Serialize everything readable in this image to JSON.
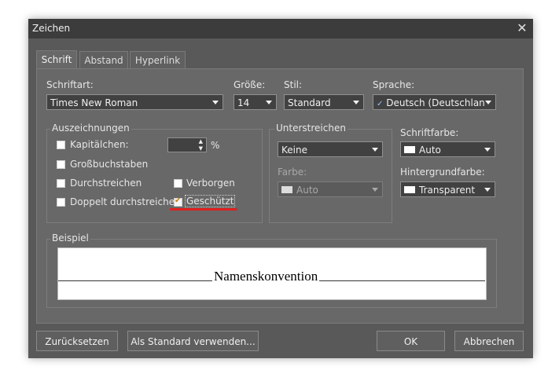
{
  "window": {
    "title": "Zeichen"
  },
  "tabs": [
    {
      "label": "Schrift"
    },
    {
      "label": "Abstand"
    },
    {
      "label": "Hyperlink"
    }
  ],
  "font_row": {
    "font_label": "Schriftart:",
    "font_value": "Times New Roman",
    "size_label": "Größe:",
    "size_value": "14",
    "style_label": "Stil:",
    "style_value": "Standard",
    "lang_label": "Sprache:",
    "lang_value": "Deutsch (Deutschlan"
  },
  "effects": {
    "group_label": "Auszeichnungen",
    "kapitaelchen": "Kapitälchen:",
    "percent": "%",
    "grossbuchstaben": "Großbuchstaben",
    "durchstreichen": "Durchstreichen",
    "verborgen": "Verborgen",
    "doppelt": "Doppelt durchstreichen",
    "geschuetzt": "Geschützt",
    "geschuetzt_checked": true
  },
  "underline": {
    "group_label": "Unterstreichen",
    "value": "Keine",
    "color_label": "Farbe:",
    "color_value": "Auto"
  },
  "colors": {
    "font_color_label": "Schriftfarbe:",
    "font_color_value": "Auto",
    "bg_color_label": "Hintergrundfarbe:",
    "bg_color_value": "Transparent"
  },
  "preview": {
    "group_label": "Beispiel",
    "text": "Namenskonvention"
  },
  "buttons": {
    "reset": "Zurücksetzen",
    "default": "Als Standard verwenden...",
    "ok": "OK",
    "cancel": "Abbrechen"
  },
  "annotation_color": "#e0201e"
}
